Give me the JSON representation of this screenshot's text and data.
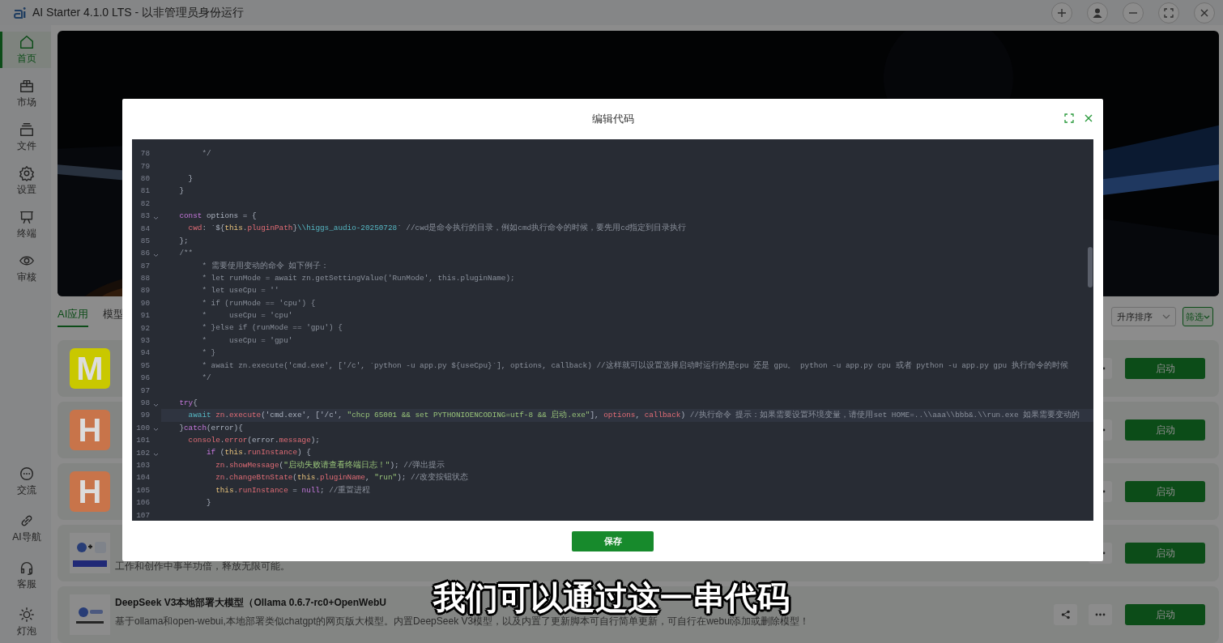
{
  "window": {
    "title": "AI Starter 4.1.0 LTS - 以非管理员身份运行"
  },
  "sidebar": {
    "items": [
      {
        "label": "首页",
        "selected": true
      },
      {
        "label": "市场",
        "selected": false
      },
      {
        "label": "文件",
        "selected": false
      },
      {
        "label": "设置",
        "selected": false
      },
      {
        "label": "终端",
        "selected": false
      },
      {
        "label": "审核",
        "selected": false
      }
    ],
    "bottom_items": [
      {
        "label": "交流",
        "selected": false
      },
      {
        "label": "AI导航",
        "selected": false
      },
      {
        "label": "客服",
        "selected": false
      },
      {
        "label": "灯泡",
        "selected": false
      }
    ]
  },
  "tabs": [
    {
      "label": "AI应用",
      "selected": true
    },
    {
      "label": "模型",
      "selected": false
    }
  ],
  "sort_select": {
    "value": "升序排序"
  },
  "filter_button": "筛选",
  "apps": [
    {
      "kind": "letter",
      "avatar": "M",
      "color": "#c9c800",
      "start_button": "启动"
    },
    {
      "kind": "letter",
      "avatar": "H",
      "color": "#c8744a",
      "start_button": "启动"
    },
    {
      "kind": "letter",
      "avatar": "H",
      "color": "#c8744a",
      "start_button": "启动"
    },
    {
      "kind": "picture",
      "description": "工作和创作中事半功倍，释放无限可能。",
      "start_button": "启动"
    },
    {
      "kind": "picture",
      "title": "DeepSeek V3本地部署大模型（Ollama 0.6.7-rc0+OpenWebU",
      "description": "基于ollama和open-webui,本地部署类似chatgpt的网页版大模型。内置DeepSeek V3模型，以及内置了更新脚本可自行简单更新，可自行在webui添加或删除模型！",
      "share_button": true,
      "start_button": "启动"
    }
  ],
  "dialog": {
    "title": "编辑代码",
    "save_button": "保存",
    "code_lines": [
      {
        "number": "78",
        "fold": false,
        "current": false,
        "segments": [
          {
            "kind": "comment",
            "text": "         */"
          }
        ]
      },
      {
        "number": "79",
        "fold": false,
        "current": false
      },
      {
        "number": "80",
        "fold": false,
        "current": false,
        "segments": [
          {
            "kind": "plain",
            "text": "      }"
          }
        ]
      },
      {
        "number": "81",
        "fold": false,
        "current": false,
        "segments": [
          {
            "kind": "plain",
            "text": "    }"
          }
        ]
      },
      {
        "number": "82",
        "fold": false,
        "current": false
      },
      {
        "number": "83",
        "fold": true,
        "current": false,
        "segments": [
          {
            "kind": "keyword",
            "text": "    const"
          },
          {
            "kind": "plain",
            "text": " options = {"
          }
        ]
      },
      {
        "number": "84",
        "fold": false,
        "current": false,
        "segments": [
          {
            "kind": "property",
            "text": "      cwd"
          },
          {
            "kind": "plain",
            "text": ": `${"
          },
          {
            "kind": "self",
            "text": "this"
          },
          {
            "kind": "plain",
            "text": "."
          },
          {
            "kind": "property",
            "text": "pluginPath"
          },
          {
            "kind": "plain",
            "text": "}"
          },
          {
            "kind": "builtin",
            "text": "\\\\higgs_audio-20250728"
          },
          {
            "kind": "plain",
            "text": "` "
          },
          {
            "kind": "comment",
            "text": "//cwd是命令执行的目录，例如cmd执行命令的时候，要先用cd指定到目录执行"
          }
        ]
      },
      {
        "number": "85",
        "fold": false,
        "current": false,
        "segments": [
          {
            "kind": "plain",
            "text": "    };"
          }
        ]
      },
      {
        "number": "86",
        "fold": true,
        "current": false,
        "segments": [
          {
            "kind": "comment",
            "text": "    /**"
          }
        ]
      },
      {
        "number": "87",
        "fold": false,
        "current": false,
        "segments": [
          {
            "kind": "comment",
            "text": "         * 需要使用变动的命令 如下例子："
          }
        ]
      },
      {
        "number": "88",
        "fold": false,
        "current": false,
        "segments": [
          {
            "kind": "comment",
            "text": "         * let runMode = await zn.getSettingValue('RunMode', this.pluginName);"
          }
        ]
      },
      {
        "number": "89",
        "fold": false,
        "current": false,
        "segments": [
          {
            "kind": "comment",
            "text": "         * let useCpu = ''"
          }
        ]
      },
      {
        "number": "90",
        "fold": false,
        "current": false,
        "segments": [
          {
            "kind": "comment",
            "text": "         * if (runMode == 'cpu') {"
          }
        ]
      },
      {
        "number": "91",
        "fold": false,
        "current": false,
        "segments": [
          {
            "kind": "comment",
            "text": "         *     useCpu = 'cpu'"
          }
        ]
      },
      {
        "number": "92",
        "fold": false,
        "current": false,
        "segments": [
          {
            "kind": "comment",
            "text": "         * }else if (runMode == 'gpu') {"
          }
        ]
      },
      {
        "number": "93",
        "fold": false,
        "current": false,
        "segments": [
          {
            "kind": "comment",
            "text": "         *     useCpu = 'gpu'"
          }
        ]
      },
      {
        "number": "94",
        "fold": false,
        "current": false,
        "segments": [
          {
            "kind": "comment",
            "text": "         * }"
          }
        ]
      },
      {
        "number": "95",
        "fold": false,
        "current": false,
        "segments": [
          {
            "kind": "comment",
            "text": "         * await zn.execute('cmd.exe', ['/c', `python -u app.py ${useCpu}`], options, callback) //这样就可以设置选择启动时运行的是cpu 还是 gpu。 python -u app.py cpu 或者 python -u app.py gpu 执行命令的时候"
          }
        ]
      },
      {
        "number": "96",
        "fold": false,
        "current": false,
        "segments": [
          {
            "kind": "comment",
            "text": "         */"
          }
        ]
      },
      {
        "number": "97",
        "fold": false,
        "current": false
      },
      {
        "number": "98",
        "fold": true,
        "current": false,
        "segments": [
          {
            "kind": "keyword",
            "text": "    try"
          },
          {
            "kind": "plain",
            "text": "{"
          }
        ]
      },
      {
        "number": "99",
        "fold": false,
        "current": true,
        "segments": [
          {
            "kind": "builtin",
            "text": "      await"
          },
          {
            "kind": "property",
            "text": " zn"
          },
          {
            "kind": "plain",
            "text": "."
          },
          {
            "kind": "property",
            "text": "execute"
          },
          {
            "kind": "plain",
            "text": "('cmd.exe', ['/c', "
          },
          {
            "kind": "string",
            "text": "\"chcp 65001 && set PYTHONIOENCODING=utf-8 && 启动.exe\""
          },
          {
            "kind": "plain",
            "text": "], "
          },
          {
            "kind": "property",
            "text": "options"
          },
          {
            "kind": "plain",
            "text": ", "
          },
          {
            "kind": "property",
            "text": "callback"
          },
          {
            "kind": "plain",
            "text": ") "
          },
          {
            "kind": "comment",
            "text": "//执行命令 提示：如果需要设置环境变量，请使用set HOME=..\\\\aaa\\\\bbb&.\\\\run.exe 如果需要变动的"
          }
        ]
      },
      {
        "number": "100",
        "fold": true,
        "current": false,
        "segments": [
          {
            "kind": "plain",
            "text": "    }"
          },
          {
            "kind": "keyword",
            "text": "catch"
          },
          {
            "kind": "plain",
            "text": "(error){"
          }
        ]
      },
      {
        "number": "101",
        "fold": false,
        "current": false,
        "segments": [
          {
            "kind": "property",
            "text": "      console"
          },
          {
            "kind": "plain",
            "text": "."
          },
          {
            "kind": "property",
            "text": "error"
          },
          {
            "kind": "plain",
            "text": "(error."
          },
          {
            "kind": "property",
            "text": "message"
          },
          {
            "kind": "plain",
            "text": ");"
          }
        ]
      },
      {
        "number": "102",
        "fold": true,
        "current": false,
        "segments": [
          {
            "kind": "keyword",
            "text": "          if"
          },
          {
            "kind": "plain",
            "text": " ("
          },
          {
            "kind": "self",
            "text": "this"
          },
          {
            "kind": "plain",
            "text": "."
          },
          {
            "kind": "property",
            "text": "runInstance"
          },
          {
            "kind": "plain",
            "text": ") {"
          }
        ]
      },
      {
        "number": "103",
        "fold": false,
        "current": false,
        "segments": [
          {
            "kind": "property",
            "text": "            zn"
          },
          {
            "kind": "plain",
            "text": "."
          },
          {
            "kind": "property",
            "text": "showMessage"
          },
          {
            "kind": "plain",
            "text": "("
          },
          {
            "kind": "string",
            "text": "\"启动失败请查看终端日志！\""
          },
          {
            "kind": "plain",
            "text": "); "
          },
          {
            "kind": "comment",
            "text": "//弹出提示"
          }
        ]
      },
      {
        "number": "104",
        "fold": false,
        "current": false,
        "segments": [
          {
            "kind": "property",
            "text": "            zn"
          },
          {
            "kind": "plain",
            "text": "."
          },
          {
            "kind": "property",
            "text": "changeBtnState"
          },
          {
            "kind": "plain",
            "text": "("
          },
          {
            "kind": "self",
            "text": "this"
          },
          {
            "kind": "plain",
            "text": "."
          },
          {
            "kind": "property",
            "text": "pluginName"
          },
          {
            "kind": "plain",
            "text": ", "
          },
          {
            "kind": "string",
            "text": "\"run\""
          },
          {
            "kind": "plain",
            "text": "); "
          },
          {
            "kind": "comment",
            "text": "//改变按钮状态"
          }
        ]
      },
      {
        "number": "105",
        "fold": false,
        "current": false,
        "segments": [
          {
            "kind": "self",
            "text": "            this"
          },
          {
            "kind": "plain",
            "text": "."
          },
          {
            "kind": "property",
            "text": "runInstance"
          },
          {
            "kind": "plain",
            "text": " = "
          },
          {
            "kind": "keyword",
            "text": "null"
          },
          {
            "kind": "plain",
            "text": "; "
          },
          {
            "kind": "comment",
            "text": "//重置进程"
          }
        ]
      },
      {
        "number": "106",
        "fold": false,
        "current": false,
        "segments": [
          {
            "kind": "plain",
            "text": "          }"
          }
        ]
      },
      {
        "number": "107",
        "fold": false,
        "current": false
      }
    ]
  },
  "subtitle": "我们可以通过这一串代码"
}
